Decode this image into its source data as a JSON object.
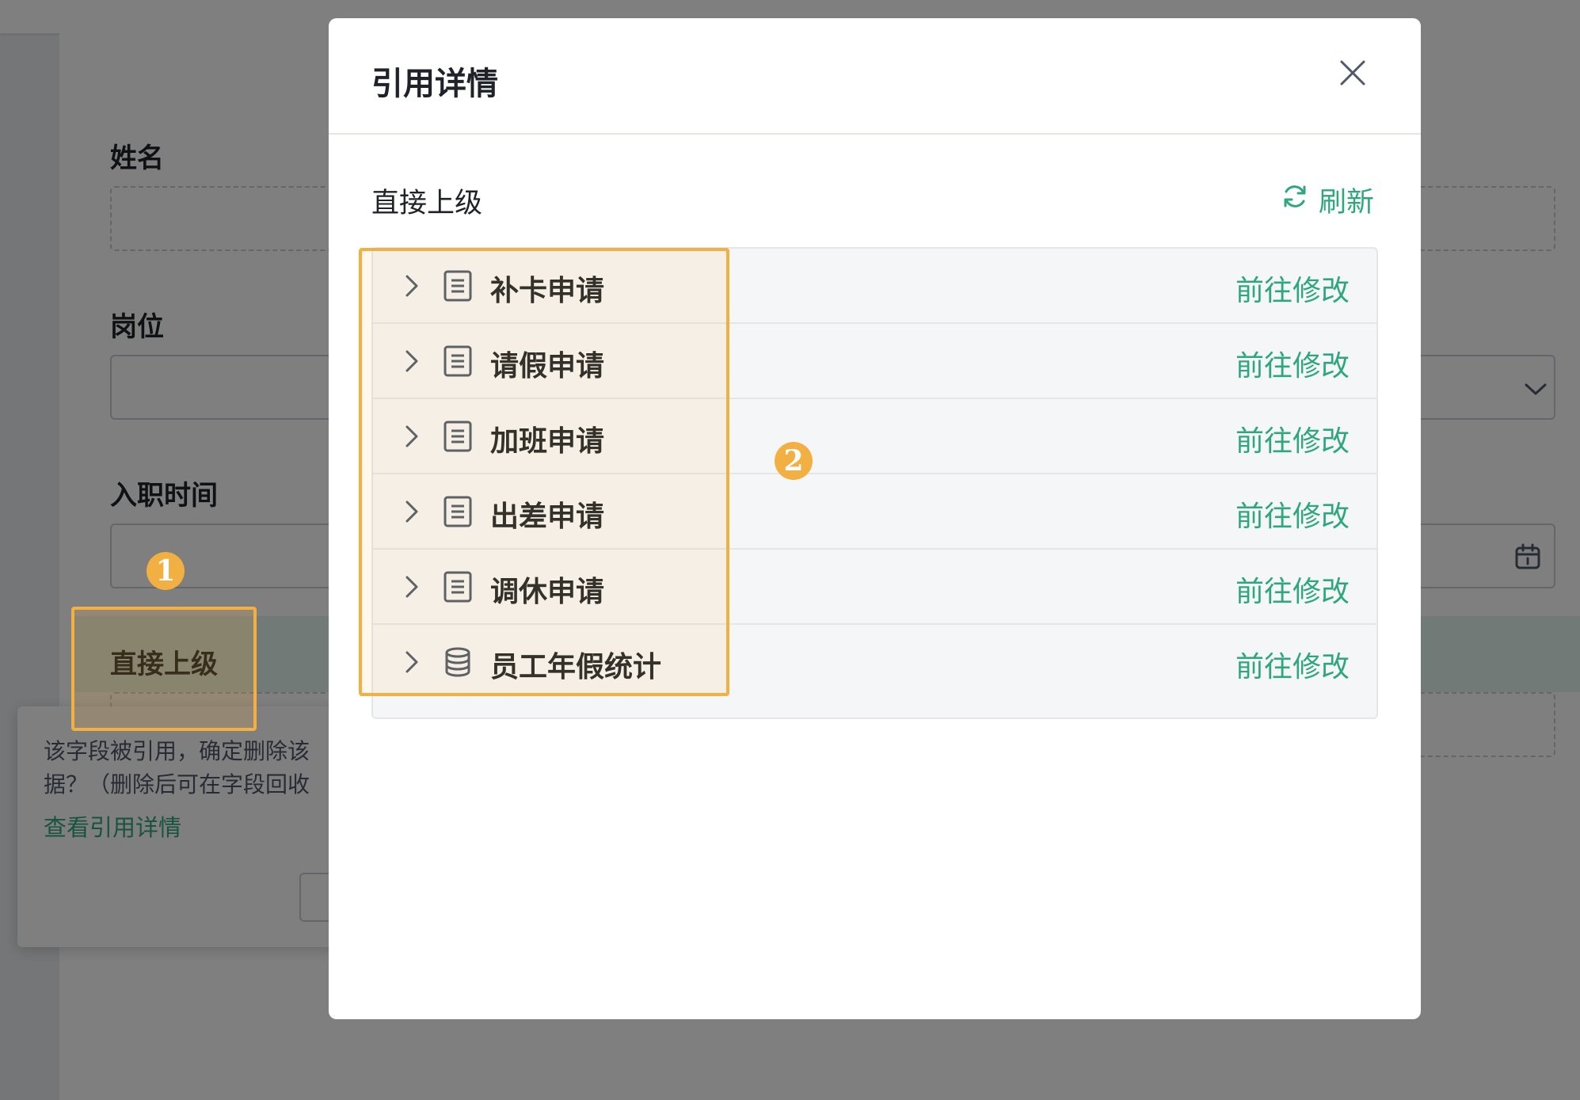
{
  "background": {
    "fields": [
      {
        "label": "姓名"
      },
      {
        "label": "岗位"
      },
      {
        "label": "入职时间"
      },
      {
        "label": "直接上级"
      }
    ],
    "popconfirm": {
      "message": "该字段被引用，确定删除该\n据？（删除后可在字段回收",
      "link": "查看引用详情"
    }
  },
  "modal": {
    "title": "引用详情",
    "section_title": "直接上级",
    "refresh_label": "刷新",
    "rows": [
      {
        "name": "补卡申请",
        "icon": "form-icon",
        "action": "前往修改"
      },
      {
        "name": "请假申请",
        "icon": "form-icon",
        "action": "前往修改"
      },
      {
        "name": "加班申请",
        "icon": "form-icon",
        "action": "前往修改"
      },
      {
        "name": "出差申请",
        "icon": "form-icon",
        "action": "前往修改"
      },
      {
        "name": "调休申请",
        "icon": "form-icon",
        "action": "前往修改"
      },
      {
        "name": "员工年假统计",
        "icon": "database-icon",
        "action": "前往修改"
      }
    ]
  },
  "annotations": {
    "badge_1": "1",
    "badge_2": "2"
  },
  "colors": {
    "accent": "#2ea77d",
    "highlight": "#f2b042"
  }
}
